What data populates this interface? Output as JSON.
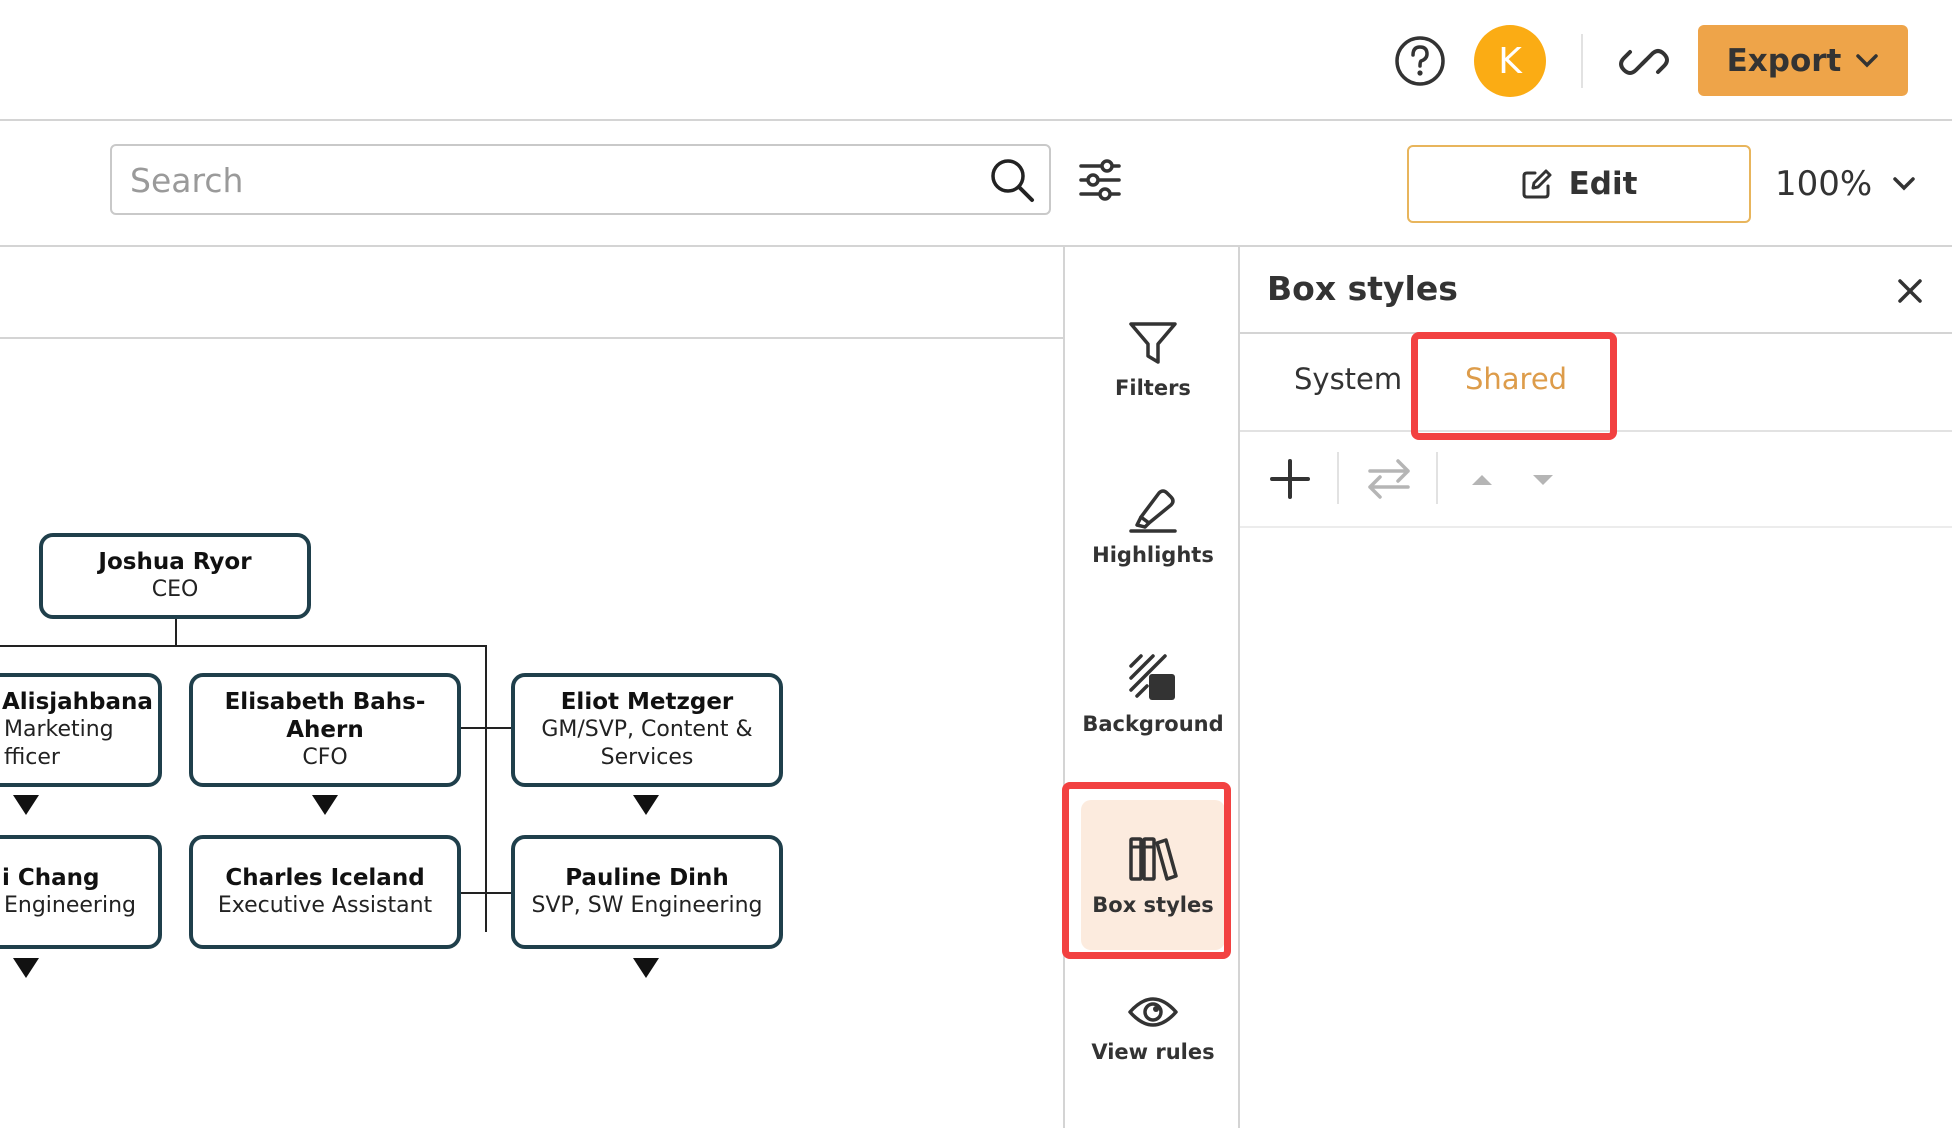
{
  "header": {
    "help_icon": "question-circle-icon",
    "avatar_initial": "K",
    "share_icon": "link-icon",
    "export_label": "Export",
    "accent_color": "#eea449",
    "avatar_color": "#fbac14"
  },
  "toolbar": {
    "search_placeholder": "Search",
    "edit_label": "Edit",
    "zoom_value": "100%"
  },
  "chart": {
    "nodes": [
      {
        "name": "Joshua Ryor",
        "title": "CEO"
      },
      {
        "name": "Alisjahbana",
        "title_lines": [
          "Marketing",
          "Officer"
        ],
        "title_lines_display": [
          "Marketing",
          "fficer"
        ]
      },
      {
        "name": "Elisabeth Bahs-Ahern",
        "name_lines": [
          "Elisabeth Bahs-",
          "Ahern"
        ],
        "title": "CFO"
      },
      {
        "name": "Eliot Metzger",
        "title_lines": [
          "GM/SVP, Content &",
          "Services"
        ]
      },
      {
        "name": "i Chang",
        "title": "Engineering"
      },
      {
        "name": "Charles Iceland",
        "title": "Executive Assistant"
      },
      {
        "name": "Pauline Dinh",
        "title": "SVP, SW Engineering"
      }
    ],
    "node_border_color": "#1f3f4b"
  },
  "rail": {
    "items": [
      {
        "label": "Filters",
        "icon": "funnel-icon"
      },
      {
        "label": "Highlights",
        "icon": "highlighter-icon"
      },
      {
        "label": "Background",
        "icon": "background-pattern-icon"
      },
      {
        "label": "Box styles",
        "icon": "books-icon",
        "active": true
      },
      {
        "label": "View rules",
        "icon": "eye-icon"
      }
    ],
    "active_bg": "#fcebde"
  },
  "panel": {
    "title": "Box styles",
    "tabs": [
      {
        "label": "System"
      },
      {
        "label": "Shared",
        "active": true
      }
    ],
    "actions": [
      "plus-icon",
      "swap-icon",
      "move-up-icon",
      "move-down-icon"
    ]
  },
  "annotations": {
    "highlight_color": "#f24141"
  }
}
